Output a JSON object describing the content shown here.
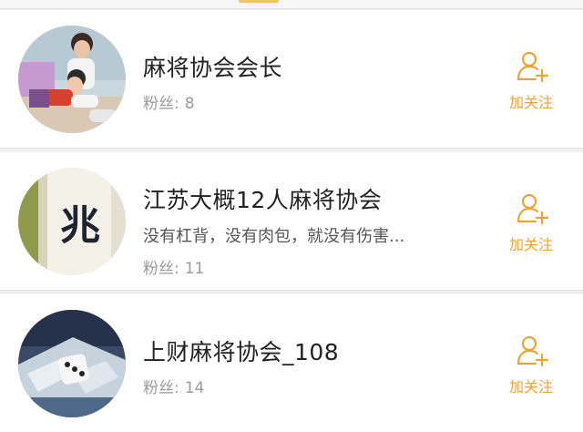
{
  "accounts": [
    {
      "name": "麻将协会会长",
      "fans_label": "粉丝:",
      "fans_count": "8",
      "follow_label": "加关注"
    },
    {
      "name": "江苏大概12人麻将协会",
      "description": "没有杠背，没有肉包，就没有伤害...",
      "fans_label": "粉丝:",
      "fans_count": "11",
      "follow_label": "加关注",
      "avatar_glyph": "兆"
    },
    {
      "name": "上财麻将协会_108",
      "fans_label": "粉丝:",
      "fans_count": "14",
      "follow_label": "加关注"
    }
  ],
  "icons": {
    "follow": "add-user-icon"
  },
  "colors": {
    "accent": "#e8a43a",
    "background": "#efeff4",
    "text_muted": "#9a9a9a"
  }
}
